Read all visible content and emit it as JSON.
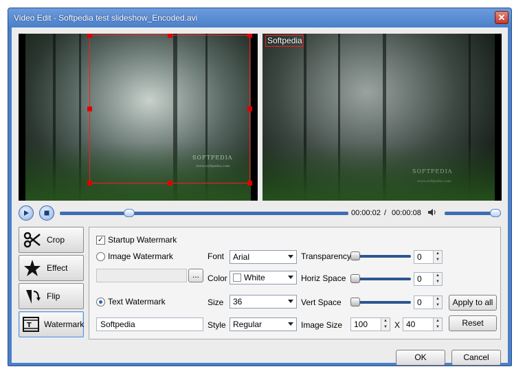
{
  "window": {
    "title": "Video Edit - Softpedia test slideshow_Encoded.avi",
    "close_glyph": "✕"
  },
  "preview": {
    "left_brand": "SOFTPEDIA",
    "left_brand_url": "www.softpedia.com",
    "right_brand": "SOFTPEDIA",
    "right_brand_url": "www.softpedia.com",
    "watermark_overlay_text": "Softpedia"
  },
  "transport": {
    "current_time": "00:00:02",
    "separator": "/",
    "total_time": "00:00:08",
    "seek_fraction": 0.24,
    "volume_fraction": 0.98
  },
  "sidebar": {
    "items": [
      {
        "label": "Crop",
        "icon": "crop-icon"
      },
      {
        "label": "Effect",
        "icon": "star-icon"
      },
      {
        "label": "Flip",
        "icon": "flip-icon"
      },
      {
        "label": "Watermark",
        "icon": "watermark-icon"
      }
    ]
  },
  "watermark": {
    "startup_label": "Startup Watermark",
    "startup_checked": true,
    "image_label": "Image Watermark",
    "image_path_value": "",
    "browse_label": "...",
    "text_label": "Text Watermark",
    "text_value": "Softpedia",
    "font_label": "Font",
    "font_value": "Arial",
    "color_label": "Color",
    "color_value": "White",
    "color_hex": "#ffffff",
    "size_label": "Size",
    "size_value": "36",
    "style_label": "Style",
    "style_value": "Regular",
    "transparency_label": "Transparency",
    "transparency_value": "0",
    "horiz_label": "Horiz Space",
    "horiz_value": "0",
    "vert_label": "Vert Space",
    "vert_value": "0",
    "image_size_label": "Image Size",
    "image_width": "100",
    "image_x": "X",
    "image_height": "40",
    "apply_all_label": "Apply to all",
    "reset_label": "Reset"
  },
  "footer": {
    "ok_label": "OK",
    "cancel_label": "Cancel"
  },
  "colors": {
    "title_bar": "#4a7fc9",
    "accent": "#3f6db3",
    "crop_rect": "#ff1a1a"
  }
}
